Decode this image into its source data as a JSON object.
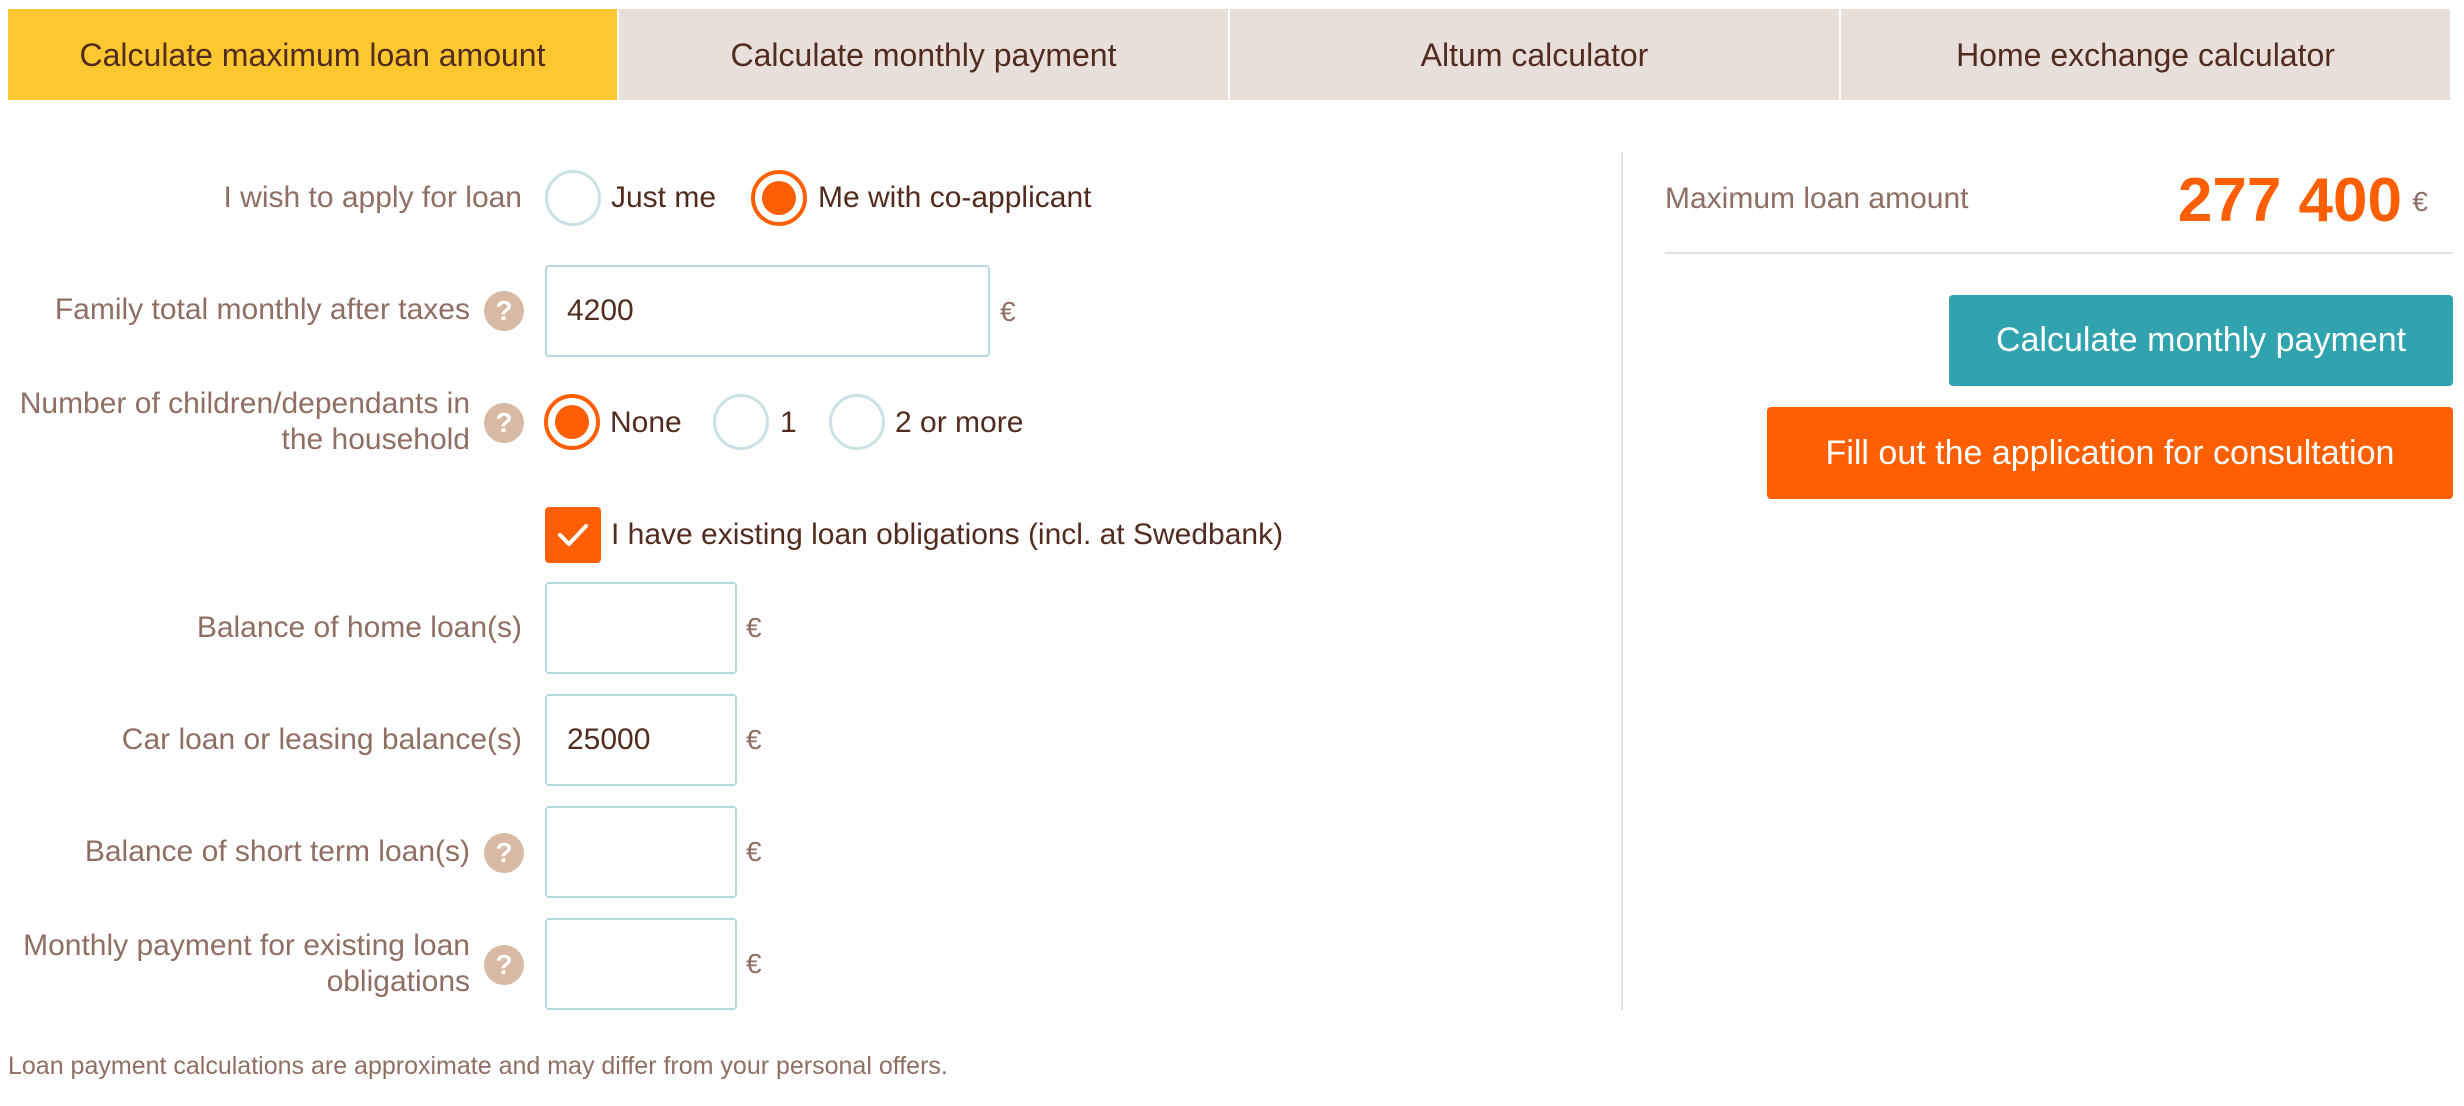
{
  "tabs": [
    {
      "label": "Calculate maximum loan amount",
      "active": true
    },
    {
      "label": "Calculate monthly payment",
      "active": false
    },
    {
      "label": "Altum calculator",
      "active": false
    },
    {
      "label": "Home exchange calculator",
      "active": false
    }
  ],
  "form": {
    "apply": {
      "label": "I wish to apply for loan",
      "options": [
        "Just me",
        "Me with co-applicant"
      ],
      "selected": "Me with co-applicant"
    },
    "income": {
      "label": "Family total monthly after taxes",
      "value": "4200",
      "currency": "€"
    },
    "children": {
      "label_line1": "Number of children/dependants in",
      "label_line2": "the household",
      "options": [
        "None",
        "1",
        "2 or more"
      ],
      "selected": "None"
    },
    "existing_loans": {
      "label": "I have existing loan obligations (incl. at Swedbank)",
      "checked": true
    },
    "home_loan": {
      "label": "Balance of home loan(s)",
      "value": "",
      "currency": "€"
    },
    "car_loan": {
      "label": "Car loan or leasing balance(s)",
      "value": "25000",
      "currency": "€"
    },
    "short_loan": {
      "label": "Balance of short term loan(s)",
      "value": "",
      "currency": "€"
    },
    "monthly_payment": {
      "label_line1": "Monthly payment for existing loan",
      "label_line2": "obligations",
      "value": "",
      "currency": "€"
    },
    "help_icon": "?"
  },
  "result": {
    "label": "Maximum loan amount",
    "value": "277 400",
    "currency": "€"
  },
  "buttons": {
    "monthly": "Calculate monthly payment",
    "consultation": "Fill out the application for consultation"
  },
  "footnote": "Loan payment calculations are approximate and may differ from your personal offers.",
  "colors": {
    "accent_orange": "#ff5f00",
    "tab_active": "#fdc82f",
    "tab_inactive": "#e8dfdb",
    "teal": "#31a3ae",
    "help_icon": "#d8b9a3"
  },
  "icons": {
    "checkbox": "check-icon",
    "help": "question-mark-icon"
  }
}
